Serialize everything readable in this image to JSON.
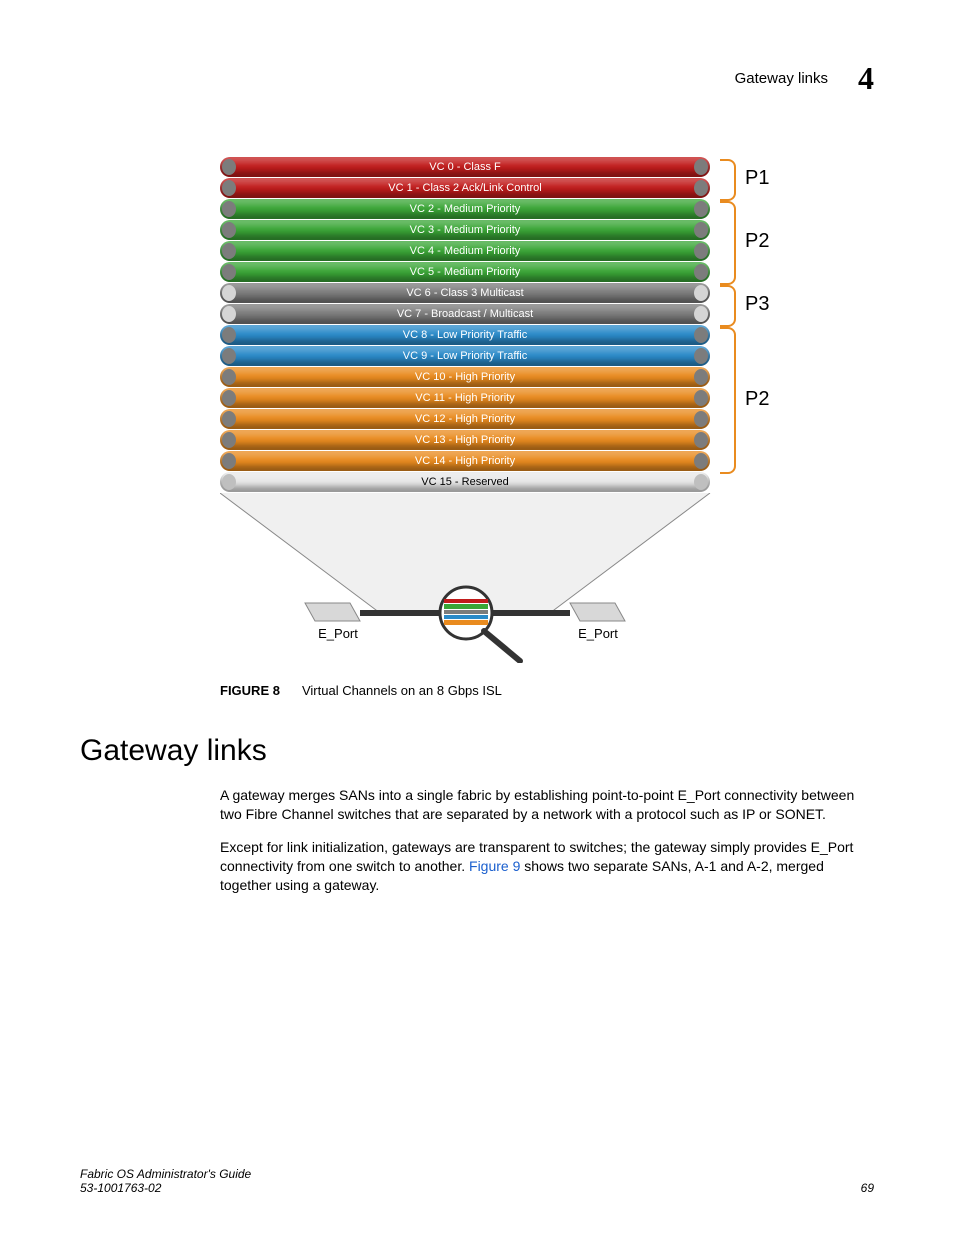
{
  "header": {
    "section": "Gateway links",
    "chapter": "4"
  },
  "figure": {
    "number": "FIGURE 8",
    "caption": "Virtual Channels on an 8 Gbps ISL",
    "eport_left": "E_Port",
    "eport_right": "E_Port",
    "bars": [
      {
        "label": "VC 0 - Class F",
        "fill": "#c11c1c",
        "cap": "#7c7c7c",
        "txt": "#fff"
      },
      {
        "label": "VC 1 - Class 2 Ack/Link Control",
        "fill": "#c11c1c",
        "cap": "#7c7c7c",
        "txt": "#fff"
      },
      {
        "label": "VC 2 - Medium Priority",
        "fill": "#3aa637",
        "cap": "#7c7c7c",
        "txt": "#fff"
      },
      {
        "label": "VC 3 - Medium Priority",
        "fill": "#3aa637",
        "cap": "#7c7c7c",
        "txt": "#fff"
      },
      {
        "label": "VC 4 - Medium Priority",
        "fill": "#3aa637",
        "cap": "#7c7c7c",
        "txt": "#fff"
      },
      {
        "label": "VC 5 - Medium Priority",
        "fill": "#3aa637",
        "cap": "#7c7c7c",
        "txt": "#fff"
      },
      {
        "label": "VC 6 - Class 3 Multicast",
        "fill": "#7c7c7c",
        "cap": "#d5d5d5",
        "txt": "#fff"
      },
      {
        "label": "VC 7 - Broadcast / Multicast",
        "fill": "#7c7c7c",
        "cap": "#d5d5d5",
        "txt": "#fff"
      },
      {
        "label": "VC 8 - Low Priority Traffic",
        "fill": "#2a8ac9",
        "cap": "#7c7c7c",
        "txt": "#fff"
      },
      {
        "label": "VC 9 - Low Priority Traffic",
        "fill": "#2a8ac9",
        "cap": "#7c7c7c",
        "txt": "#fff"
      },
      {
        "label": "VC 10 - High Priority",
        "fill": "#e98b1f",
        "cap": "#7c7c7c",
        "txt": "#fff"
      },
      {
        "label": "VC 11 - High Priority",
        "fill": "#e98b1f",
        "cap": "#7c7c7c",
        "txt": "#fff"
      },
      {
        "label": "VC 12 - High Priority",
        "fill": "#e98b1f",
        "cap": "#7c7c7c",
        "txt": "#fff"
      },
      {
        "label": "VC 13 - High Priority",
        "fill": "#e98b1f",
        "cap": "#7c7c7c",
        "txt": "#fff"
      },
      {
        "label": "VC 14 - High Priority",
        "fill": "#e98b1f",
        "cap": "#7c7c7c",
        "txt": "#fff"
      },
      {
        "label": "VC 15 - Reserved",
        "fill": "#e8e8e8",
        "cap": "#bfbfbf",
        "txt": "#000"
      }
    ],
    "groups": [
      {
        "label": "P1",
        "from": 0,
        "to": 1
      },
      {
        "label": "P2",
        "from": 2,
        "to": 5
      },
      {
        "label": "P3",
        "from": 6,
        "to": 7
      },
      {
        "label": "P2",
        "from": 8,
        "to": 14
      }
    ]
  },
  "section": {
    "heading": "Gateway links",
    "p1": "A gateway merges SANs into a single fabric by establishing point-to-point E_Port connectivity between two Fibre Channel switches that are separated by a network with a protocol such as IP or SONET.",
    "p2a": "Except for link initialization, gateways are transparent to switches; the gateway simply provides E_Port connectivity from one switch to another. ",
    "p2link": "Figure 9",
    "p2b": " shows two separate SANs, A-1 and A-2, merged together using a gateway."
  },
  "footer": {
    "title": "Fabric OS Administrator's Guide",
    "docnum": "53-1001763-02",
    "page": "69"
  }
}
